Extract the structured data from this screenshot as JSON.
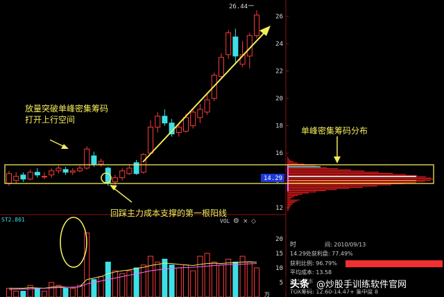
{
  "chart_data": {
    "type": "candlestick",
    "price_axis": {
      "ticks": [
        "26",
        "24",
        "22",
        "20",
        "18",
        "16",
        "14",
        "12"
      ],
      "range": [
        11.5,
        27.2
      ]
    },
    "peak_label": "26.44",
    "current_price_box": "14.29",
    "candles": [
      {
        "o": 13.8,
        "c": 14.5,
        "h": 14.7,
        "l": 13.6
      },
      {
        "o": 14.0,
        "c": 14.3,
        "h": 14.6,
        "l": 13.8
      },
      {
        "o": 14.4,
        "c": 14.1,
        "h": 14.6,
        "l": 13.9
      },
      {
        "o": 14.1,
        "c": 14.6,
        "h": 14.8,
        "l": 14.0
      },
      {
        "o": 14.6,
        "c": 14.4,
        "h": 14.9,
        "l": 14.2
      },
      {
        "o": 14.3,
        "c": 14.3,
        "h": 14.6,
        "l": 14.1
      },
      {
        "o": 14.4,
        "c": 14.7,
        "h": 14.9,
        "l": 14.2
      },
      {
        "o": 14.7,
        "c": 14.9,
        "h": 15.1,
        "l": 14.5
      },
      {
        "o": 14.8,
        "c": 14.6,
        "h": 15.0,
        "l": 14.4
      },
      {
        "o": 14.6,
        "c": 14.7,
        "h": 14.9,
        "l": 14.4
      },
      {
        "o": 14.7,
        "c": 14.9,
        "h": 15.1,
        "l": 14.6
      },
      {
        "o": 14.9,
        "c": 16.3,
        "h": 16.5,
        "l": 14.8
      },
      {
        "o": 15.8,
        "c": 15.2,
        "h": 16.1,
        "l": 15.0
      },
      {
        "o": 15.2,
        "c": 15.4,
        "h": 15.6,
        "l": 15.0
      },
      {
        "o": 14.9,
        "c": 13.8,
        "h": 15.0,
        "l": 13.6
      },
      {
        "o": 13.9,
        "c": 14.2,
        "h": 14.4,
        "l": 13.6
      },
      {
        "o": 14.2,
        "c": 14.7,
        "h": 14.9,
        "l": 14.0
      },
      {
        "o": 14.5,
        "c": 14.9,
        "h": 15.1,
        "l": 14.4
      },
      {
        "o": 15.3,
        "c": 14.5,
        "h": 15.5,
        "l": 14.4
      },
      {
        "o": 14.6,
        "c": 15.9,
        "h": 16.0,
        "l": 14.5
      },
      {
        "o": 16.0,
        "c": 17.9,
        "h": 18.4,
        "l": 15.9
      },
      {
        "o": 17.9,
        "c": 18.7,
        "h": 19.0,
        "l": 17.5
      },
      {
        "o": 18.7,
        "c": 18.2,
        "h": 19.2,
        "l": 18.0
      },
      {
        "o": 18.2,
        "c": 17.4,
        "h": 18.5,
        "l": 17.2
      },
      {
        "o": 17.5,
        "c": 17.9,
        "h": 18.2,
        "l": 17.2
      },
      {
        "o": 17.6,
        "c": 18.6,
        "h": 18.9,
        "l": 17.5
      },
      {
        "o": 18.0,
        "c": 19.0,
        "h": 19.3,
        "l": 17.8
      },
      {
        "o": 18.6,
        "c": 19.2,
        "h": 19.6,
        "l": 18.2
      },
      {
        "o": 19.0,
        "c": 19.9,
        "h": 20.3,
        "l": 18.8
      },
      {
        "o": 20.0,
        "c": 21.7,
        "h": 21.9,
        "l": 19.8
      },
      {
        "o": 21.6,
        "c": 23.0,
        "h": 23.3,
        "l": 21.4
      },
      {
        "o": 23.2,
        "c": 24.8,
        "h": 25.0,
        "l": 22.9
      },
      {
        "o": 24.5,
        "c": 23.1,
        "h": 25.1,
        "l": 22.6
      },
      {
        "o": 22.5,
        "c": 23.2,
        "h": 24.2,
        "l": 22.3
      },
      {
        "o": 23.1,
        "c": 24.6,
        "h": 24.8,
        "l": 22.2
      },
      {
        "o": 24.6,
        "c": 26.1,
        "h": 26.44,
        "l": 24.4
      }
    ],
    "volume": {
      "label_ma": "ST2.801",
      "label_vol": "VOL",
      "axis_ticks": [
        "20",
        "15",
        "10",
        "5"
      ],
      "axis_unit": "万",
      "range": [
        0,
        24
      ],
      "values": [
        3,
        2,
        2,
        4,
        3,
        2,
        5,
        4,
        3,
        3,
        4,
        22,
        6,
        7,
        12,
        9,
        8,
        9,
        10,
        11,
        14,
        12,
        13,
        11,
        10,
        11,
        9,
        14,
        15,
        12,
        11,
        13,
        12,
        14,
        12,
        10
      ],
      "up": [
        1,
        1,
        0,
        1,
        0,
        1,
        1,
        1,
        0,
        1,
        1,
        1,
        0,
        1,
        0,
        1,
        1,
        1,
        0,
        1,
        1,
        1,
        0,
        0,
        1,
        1,
        1,
        1,
        1,
        1,
        1,
        1,
        0,
        1,
        1,
        1
      ],
      "ma1": [
        3,
        3,
        3,
        3.2,
        3.1,
        3,
        3.4,
        3.6,
        3.4,
        3.3,
        3.5,
        6,
        6.5,
        7,
        8,
        8.6,
        9,
        9.3,
        9.8,
        10.2,
        10.8,
        11.2,
        11.6,
        11.5,
        11.2,
        11,
        10.8,
        11.2,
        11.5,
        11.6,
        11.5,
        11.7,
        11.8,
        12,
        12.1,
        11.9
      ],
      "ma2": [
        2.5,
        2.6,
        2.7,
        2.8,
        2.9,
        3,
        3.1,
        3.2,
        3.3,
        3.4,
        3.5,
        4.5,
        5,
        5.5,
        6,
        6.5,
        7,
        7.5,
        8,
        8.5,
        9,
        9.3,
        9.6,
        9.8,
        10,
        10.1,
        10.2,
        10.4,
        10.6,
        10.8,
        11,
        11.1,
        11.2,
        11.3,
        11.4,
        11.5
      ]
    },
    "chip_distribution": {
      "peak_range": [
        13.2,
        15.0
      ],
      "heavy_band": [
        14.0,
        14.8
      ],
      "title": "单峰密集筹码分布"
    }
  },
  "annotations": {
    "breakout_line1": "放量突破单峰密集筹码",
    "breakout_line2": "打开上行空间",
    "support_text": "回踩主力成本支撑的第一根阳线",
    "chip_title": "单峰密集筹码分布"
  },
  "info_panel": {
    "date_label": "时",
    "date_value": "间: 2010/09/13",
    "profit_text": "14.29处获利盘: 77.49%",
    "ratio_label": "获利比例: 96.79%",
    "avg_cost": "平均成本: 13.58",
    "percent90": "90%成本",
    "tox_row": "TOX筹码: 12.60-14.47+ 集中度 8"
  },
  "watermark": {
    "brand": "头条",
    "account": "@炒股手训练软件官网"
  },
  "colors": {
    "up": "#ff3b3b",
    "down": "#3de0e6",
    "arrow": "#f2ec5b",
    "box": "#f2ec5b",
    "chip": "#ff2020",
    "grid": "#7a1010"
  }
}
